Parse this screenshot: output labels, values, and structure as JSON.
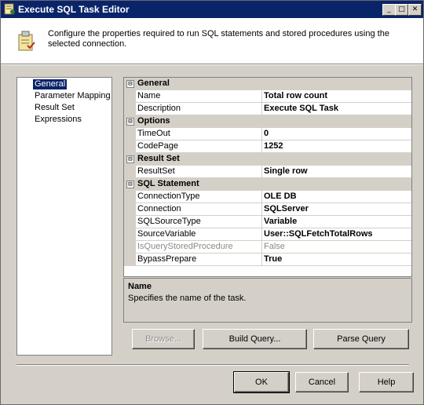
{
  "window": {
    "title": "Execute SQL Task Editor",
    "controls": {
      "minimize": "_",
      "maximize": "□",
      "close": "✕"
    }
  },
  "header": {
    "description": "Configure the properties required to run SQL statements and stored procedures using the selected connection."
  },
  "nav": {
    "items": [
      {
        "label": "General",
        "selected": true
      },
      {
        "label": "Parameter Mapping",
        "selected": false
      },
      {
        "label": "Result Set",
        "selected": false
      },
      {
        "label": "Expressions",
        "selected": false
      }
    ]
  },
  "grid": {
    "categories": [
      {
        "expander": "⊟",
        "label": "General",
        "props": [
          {
            "name": "Name",
            "value": "Total row count"
          },
          {
            "name": "Description",
            "value": "Execute SQL Task"
          }
        ]
      },
      {
        "expander": "⊟",
        "label": "Options",
        "props": [
          {
            "name": "TimeOut",
            "value": "0"
          },
          {
            "name": "CodePage",
            "value": "1252"
          }
        ]
      },
      {
        "expander": "⊟",
        "label": "Result Set",
        "props": [
          {
            "name": "ResultSet",
            "value": "Single row"
          }
        ]
      },
      {
        "expander": "⊟",
        "label": "SQL Statement",
        "props": [
          {
            "name": "ConnectionType",
            "value": "OLE DB"
          },
          {
            "name": "Connection",
            "value": "SQLServer"
          },
          {
            "name": "SQLSourceType",
            "value": "Variable"
          },
          {
            "name": "SourceVariable",
            "value": "User::SQLFetchTotalRows"
          },
          {
            "name": "IsQueryStoredProcedure",
            "value": "False",
            "disabled": true
          },
          {
            "name": "BypassPrepare",
            "value": "True"
          }
        ]
      }
    ]
  },
  "description_panel": {
    "title": "Name",
    "text": "Specifies the name of the task."
  },
  "buttons": {
    "browse": "Browse...",
    "build_query": "Build Query...",
    "parse_query": "Parse Query",
    "ok": "OK",
    "cancel": "Cancel",
    "help": "Help"
  },
  "colors": {
    "titlebar": "#0a246a",
    "face": "#d4d0c8",
    "selection": "#0a246a"
  }
}
